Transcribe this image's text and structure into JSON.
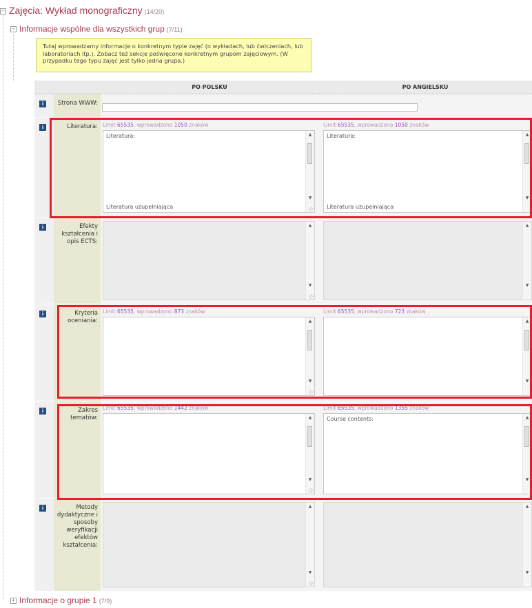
{
  "tree": {
    "top": {
      "toggle": "−",
      "title": "Zajęcia: Wykład monograficzny",
      "count": "(14/20)"
    },
    "section": {
      "toggle": "−",
      "title": "Informacje wspólne dla wszystkich grup",
      "count": "(7/11)"
    },
    "group": {
      "toggle": "+",
      "title": "Informacje o grupie 1",
      "count": "(7/9)"
    }
  },
  "note": "Tutaj wprowadzamy informacje o konkretnym typie zajęć (o wykładach, lub ćwiczeniach, lub laboratoriach itp.). Zobacz też sekcje poświęcone konkretnym grupom zajęciowym. (W przypadku tego typu zajęć jest tylko jedna grupa.)",
  "columns": {
    "pl": "PO POLSKU",
    "en": "PO ANGIELSKU"
  },
  "info_icon": "i",
  "fields": {
    "www": {
      "label": "Strona WWW:",
      "value": ""
    },
    "literatura": {
      "label": "Literatura:",
      "pl": {
        "hint_prefix": "Limit",
        "limit": "65535",
        "hint_mid": ", wprowadzono",
        "count": "1050",
        "hint_suffix": "znaków",
        "line1": "Literatura:",
        "line2": "Literatura uzupełniająca"
      },
      "en": {
        "hint_prefix": "Limit",
        "limit": "65535",
        "hint_mid": ", wprowadzono",
        "count": "1050",
        "hint_suffix": "znaków",
        "line1": "Literatura:",
        "line2": "Literatura uzupełniająca"
      }
    },
    "efekty": {
      "label": "Efekty kształcenia i opis ECTS:"
    },
    "kryteria": {
      "label": "Kryteria oceniania:",
      "pl": {
        "hint_prefix": "Limit",
        "limit": "65535",
        "hint_mid": ", wprowadzono",
        "count": "873",
        "hint_suffix": "znaków"
      },
      "en": {
        "hint_prefix": "Limit",
        "limit": "65535",
        "hint_mid": ", wprowadzono",
        "count": "723",
        "hint_suffix": "znaków"
      }
    },
    "zakres": {
      "label": "Zakres tematów:",
      "pl": {
        "hint_prefix": "Limit",
        "limit": "65535",
        "hint_mid": ", wprowadzono",
        "count": "1442",
        "hint_suffix": "znaków"
      },
      "en": {
        "hint_prefix": "Limit",
        "limit": "65535",
        "hint_mid": ", wprowadzono",
        "count": "1355",
        "hint_suffix": "znaków",
        "line1": "Course contents:"
      }
    },
    "metody": {
      "label": "Metody dydaktyczne i sposoby weryfikacji efektów kształcenia:"
    }
  },
  "colors": {
    "highlight": "#e41e2b",
    "tree_title": "#a33b4e",
    "note_bg": "#fdfdb4",
    "label_col": "#e9e9d3"
  }
}
